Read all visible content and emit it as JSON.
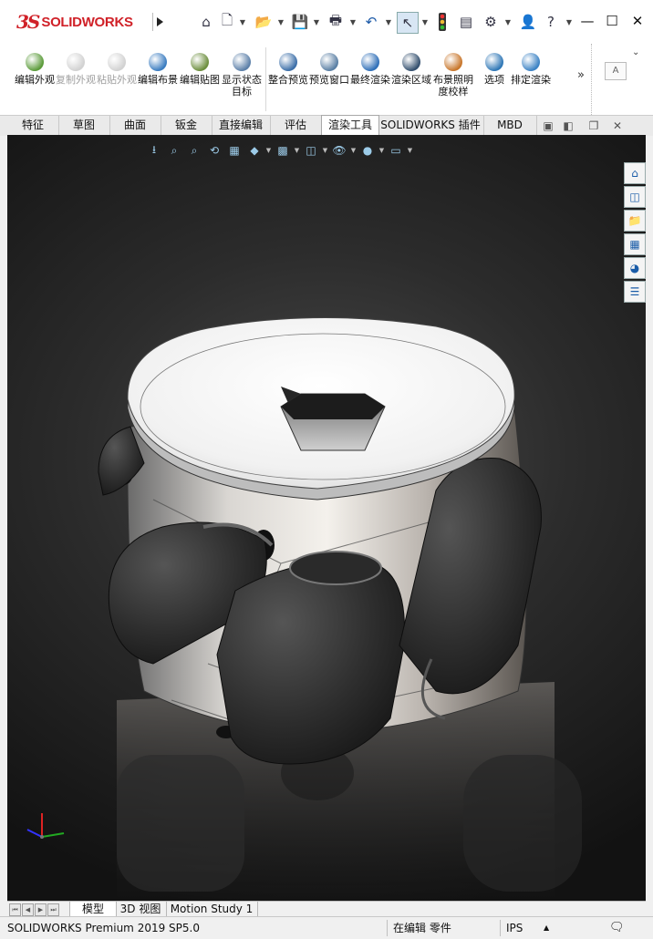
{
  "app": {
    "logo_prefix": "3S",
    "logo_name": "SOLIDWORKS"
  },
  "quick_access": [
    "home-icon",
    "new-document-icon",
    "open-icon",
    "save-icon",
    "print-icon",
    "undo-icon",
    "select-icon",
    "rebuild-icon",
    "file-properties-icon",
    "options-icon",
    "user-icon",
    "help-icon"
  ],
  "window": {
    "help_label": "?",
    "minimize": "—",
    "restore": "☐",
    "close": "✕"
  },
  "ribbon": {
    "buttons": [
      {
        "label": "编辑外观",
        "color": "#5b9b3a",
        "disabled": false
      },
      {
        "label": "复制外观",
        "color": "#9a9a9a",
        "disabled": true
      },
      {
        "label": "粘贴外观",
        "color": "#9a9a9a",
        "disabled": true
      },
      {
        "label": "编辑布景",
        "color": "#3a7cc0",
        "disabled": false
      },
      {
        "label": "编辑贴图",
        "color": "#6c8e3d",
        "disabled": false
      },
      {
        "label": "显示状态目标",
        "color": "#5b7fa8",
        "disabled": false
      },
      {
        "label": "整合预览",
        "color": "#3b6ea8",
        "disabled": false
      },
      {
        "label": "预览窗口",
        "color": "#5a7fa4",
        "disabled": false
      },
      {
        "label": "最终渲染",
        "color": "#2f6fb8",
        "disabled": false
      },
      {
        "label": "渲染区域",
        "color": "#334f6e",
        "disabled": false
      },
      {
        "label": "布景照明度校样",
        "color": "#c8762b",
        "disabled": false
      },
      {
        "label": "选项",
        "color": "#2f77b6",
        "disabled": false
      },
      {
        "label": "排定渲染",
        "color": "#3b82c4",
        "disabled": false
      }
    ],
    "more": "»"
  },
  "tabs": [
    {
      "label": "特征",
      "active": false
    },
    {
      "label": "草图",
      "active": false
    },
    {
      "label": "曲面",
      "active": false
    },
    {
      "label": "钣金",
      "active": false
    },
    {
      "label": "直接编辑",
      "active": false
    },
    {
      "label": "评估",
      "active": false
    },
    {
      "label": "渲染工具",
      "active": true
    },
    {
      "label": "SOLIDWORKS 插件",
      "active": false
    },
    {
      "label": "MBD",
      "active": false
    }
  ],
  "heads_up_icons": [
    "zoom-to-fit-icon",
    "zoom-to-area-icon",
    "previous-view-icon",
    "section-view-icon",
    "dynamic-annotation-icon",
    "view-orientation-icon",
    "display-style-icon",
    "hide-show-items-icon",
    "edit-appearance-icon",
    "apply-scene-icon",
    "view-settings-icon"
  ],
  "task_pane_icons": [
    "solidworks-resources-icon",
    "design-library-icon",
    "file-explorer-icon",
    "view-palette-icon",
    "appearances-icon",
    "custom-properties-icon"
  ],
  "bottom_tabs": [
    {
      "label": "模型",
      "active": true
    },
    {
      "label": "3D 视图",
      "active": false
    },
    {
      "label": "Motion Study 1",
      "active": false
    }
  ],
  "status": {
    "product": "SOLIDWORKS Premium 2019 SP5.0",
    "mode": "在编辑 零件",
    "units": "IPS"
  },
  "colors": {
    "brand_red": "#d02128",
    "tab_active": "#ffffff",
    "viewport_bg": "#2c2c2c"
  }
}
